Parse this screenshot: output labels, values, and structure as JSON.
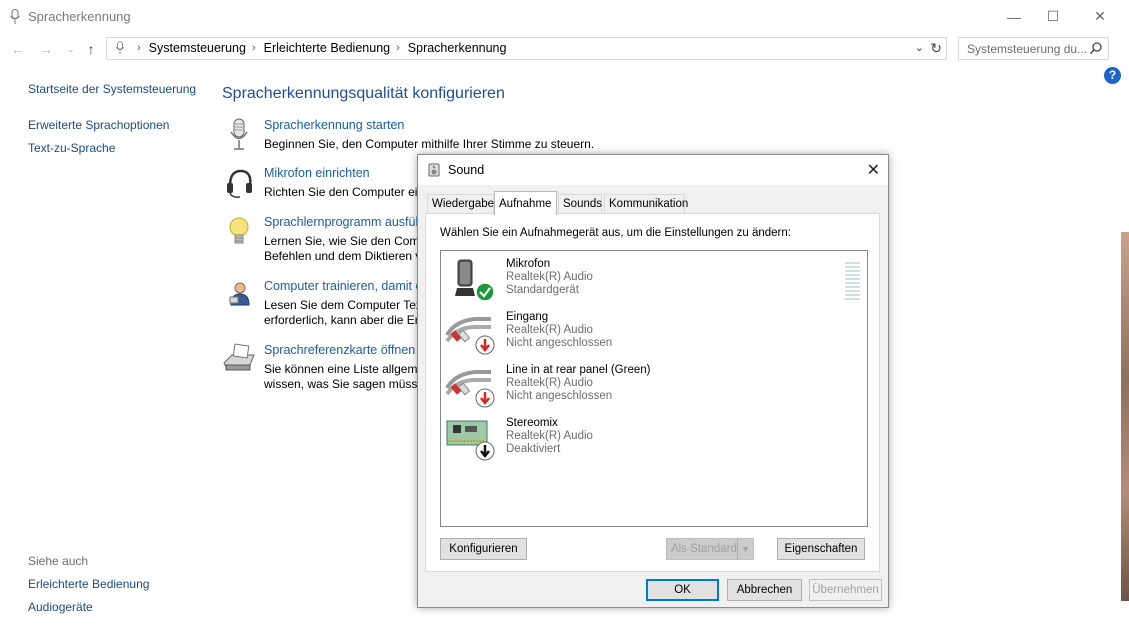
{
  "window": {
    "title": "Spracherkennung"
  },
  "nav": {
    "crumbs": [
      "Systemsteuerung",
      "Erleichterte Bedienung",
      "Spracherkennung"
    ],
    "search_placeholder": "Systemsteuerung du..."
  },
  "left": {
    "links": [
      "Startseite der Systemsteuerung",
      "Erweiterte Sprachoptionen",
      "Text-zu-Sprache"
    ],
    "see_also_label": "Siehe auch",
    "see_also": [
      "Erleichterte Bedienung",
      "Audiogeräte"
    ]
  },
  "main": {
    "title": "Spracherkennungsqualität konfigurieren",
    "tasks": [
      {
        "link": "Spracherkennung starten",
        "desc1": "Beginnen Sie, den Computer mithilfe Ihrer Stimme zu steuern.",
        "desc2": ""
      },
      {
        "link": "Mikrofon einrichten",
        "desc1": "Richten Sie den Computer ein",
        "desc2": ""
      },
      {
        "link": "Sprachlernprogramm ausfüh",
        "desc1": "Lernen Sie, wie Sie den Comp",
        "desc2": "Befehlen und dem Diktieren v"
      },
      {
        "link": "Computer trainieren, damit e",
        "desc1": "Lesen Sie dem Computer Text",
        "desc2": "erforderlich, kann aber die Erk"
      },
      {
        "link": "Sprachreferenzkarte öffnen",
        "desc1": "Sie können eine Liste allgeme",
        "desc2": "wissen, was Sie sagen müssen"
      }
    ]
  },
  "dialog": {
    "title": "Sound",
    "tabs": [
      "Wiedergabe",
      "Aufnahme",
      "Sounds",
      "Kommunikation"
    ],
    "hint": "Wählen Sie ein Aufnahmegerät aus, um die Einstellungen zu ändern:",
    "devices": [
      {
        "name": "Mikrofon",
        "driver": "Realtek(R) Audio",
        "status": "Standardgerät"
      },
      {
        "name": "Eingang",
        "driver": "Realtek(R) Audio",
        "status": "Nicht angeschlossen"
      },
      {
        "name": "Line in at rear panel (Green)",
        "driver": "Realtek(R) Audio",
        "status": "Nicht angeschlossen"
      },
      {
        "name": "Stereomix",
        "driver": "Realtek(R) Audio",
        "status": "Deaktiviert"
      }
    ],
    "buttons": {
      "configure": "Konfigurieren",
      "set_default": "Als Standard",
      "properties": "Eigenschaften",
      "ok": "OK",
      "cancel": "Abbrechen",
      "apply": "Übernehmen"
    }
  }
}
